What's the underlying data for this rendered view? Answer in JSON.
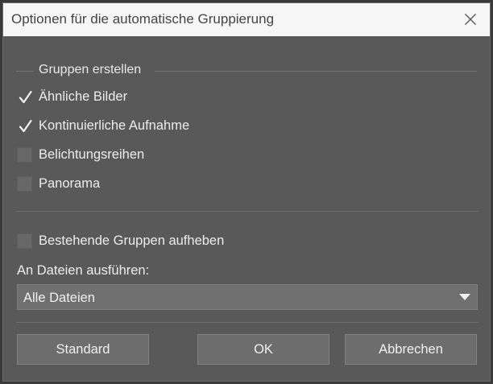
{
  "dialog": {
    "title": "Optionen für die automatische Gruppierung"
  },
  "group": {
    "label": "Gruppen erstellen",
    "options": [
      {
        "label": "Ähnliche Bilder",
        "checked": true
      },
      {
        "label": "Kontinuierliche Aufnahme",
        "checked": true
      },
      {
        "label": "Belichtungsreihen",
        "checked": false
      },
      {
        "label": "Panorama",
        "checked": false
      }
    ]
  },
  "ungroup": {
    "label": "Bestehende Gruppen aufheben",
    "checked": false
  },
  "apply": {
    "label": "An Dateien ausführen:",
    "selected": "Alle Dateien"
  },
  "buttons": {
    "standard": "Standard",
    "ok": "OK",
    "cancel": "Abbrechen"
  },
  "icons": {
    "close": "close-icon",
    "check": "checkmark-icon",
    "dropdown": "chevron-down-icon"
  }
}
